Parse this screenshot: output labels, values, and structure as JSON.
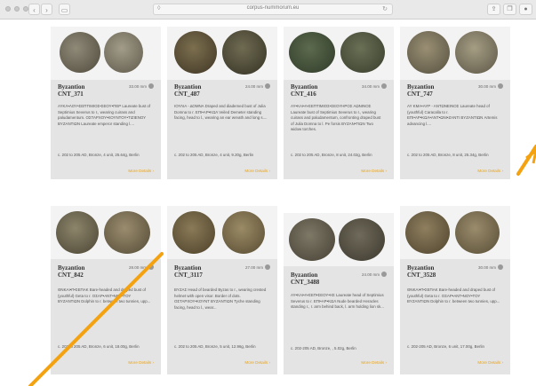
{
  "browser": {
    "url": "corpus-nummorum.eu",
    "back_icon": "chevron-left",
    "forward_icon": "chevron-right",
    "sidebar_icon": "sidebar",
    "shield_icon": "shield",
    "reload_icon": "reload",
    "share_icon": "share",
    "tabs_icon": "tabs",
    "download_icon": "download"
  },
  "accent_color": "#e8a41c",
  "cards": [
    {
      "city": "Byzantion",
      "id": "CNT_371",
      "size": "33.00 mm",
      "desc": "ΑΥΚΛ•ΛΟΥ•ΣΕΠΤΙΜΙΟΣ•ΣΕΟΥ•ΠΕΡ Laureate bust of Septimius Severus to r., wearing cuirass and paludamentum. ΟΣΤΑΡΧΟΥ•ΚΟΥΝΤΟΥ•ΤΙΖΙΕΝΟΥ ΒΥΖΑΝΤΙΩΝ Laureate emperor standing l....",
      "meta": "c. 202 to 205 AD, Bronze, 4 unit, 25.64g, Berlin",
      "more": "More Details ›"
    },
    {
      "city": "Byzantion",
      "id": "CNT_487",
      "size": "24.00 mm",
      "desc": "ΙΟΥΛΙΑ - ΔΟΜΝΑ Draped and diademed bust of Julia Domna to r. ΕΠΙ•ΑΡ•ΚΩΛ Veiled Demeter standing facing, head to l., wearing an ear wreath and long s....",
      "meta": "c. 202 to 205 AD, Bronze, 4 unit, 9.20g, Berlin",
      "more": "More Details ›"
    },
    {
      "city": "Byzantion",
      "id": "CNT_416",
      "size": "34.00 mm",
      "desc": "ΑΥ•ΚΑΙ•Λ•ΣΕΠΤΙΜΙΟΣ•ΣΕΟΥΗΡΟΣ ΑΩΝΙΝΟΣ Laureate bust of Septimius Severus to r., wearing cuirass and paludamentum, confronting draped bust of Julia Domna to l. Pe forsis ΒΥΖΑΝ•ΤΙΩΝ Two widow torches.",
      "meta": "c. 202 to 205 AD, Bronze, 8 unit, 24.02g, Berlin",
      "more": "More Details ›"
    },
    {
      "city": "Byzantion",
      "id": "CNT_747",
      "size": "30.00 mm",
      "desc": "ΑΥ ΚΜΑ•ΑΥΡ - ΑΝΤΩΝΕΙΝΟΣ Laureate head of (youthful) Caracalla to r. ΕΠΙ•ΑΡ•ΚΩΛ•ΑΝΤ•ΩΝΙ•ΖΑΝΤΙ ΒΥΖΑΝΤΙΩΝ Artemis advancing l....",
      "meta": "c. 202 to 205 AD, Bronze, 8 unit, 25.34g, Berlin",
      "more": "More Details ›"
    },
    {
      "city": "Byzantion",
      "id": "CNT_842",
      "size": "28.00 mm",
      "desc": "ΘΝΚΑΙ•Π•ΣΕΠΑΚ Bare-headed and draped bust of (youthful) Geta to r. ΟΣΑΡ•ΑΝΤ•ΝΟΥ•ΤΟΥ ΒΥΖΑΝΤΙΩΝ Dolphin to r. between two tunnies, upp...",
      "meta": "c. 202 to 205 AD, Bronze, 6 unit, 18.00g, Berlin",
      "more": "More Details ›"
    },
    {
      "city": "Byzantion",
      "id": "CNT_3117",
      "size": "27.00 mm",
      "desc": "ΒΥΖΑΣ Head of bearded Byzas to r., wearing crested helmet with open visor. Border of dots. ΟΣΤΑΡΧΟΥ•ΚΟΥΝΤ ΒΥΖΑΝΤΙΩΝ Tyche standing facing, head to l., wear...",
      "meta": "c. 202 to 205 AD, Bronze, 5 unit, 12.96g, Berlin",
      "more": "More Details ›"
    },
    {
      "city": "Byzantion",
      "id": "CNT_3488",
      "size": "24.00 mm",
      "desc": "ΑΥ•ΚΑΙ•Λ•ΣΕΠ•ΣΕΟΥ•ΗΣ Laureate head of Septimius Severus to r. ΕΠΙ•ΑΡ•ΚΩΛ Nude bearded Heracles standing r., r. arm behind back, l. arm holding lion sk...",
      "meta": "c. 202-205 AD, Bronze, , 5.02g, Berlin",
      "more": "More Details ›"
    },
    {
      "city": "Byzantion",
      "id": "CNT_3528",
      "size": "30.00 mm",
      "desc": "ΘΝΚΑΙ•Π•ΣΕΠΑΚ Bare-headed and draped bust of (youthful) Geta to r. ΟΣΑΡ•ΑΝΤ•ΝΟΥ•ΤΟΥ ΒΥΖΑΝΤΙΩΝ Dolphin to r. between two tunnies, upp...",
      "meta": "c. 202-205 AD, Bronze, 6 unit, 17.00g, Berlin",
      "more": "More Details ›"
    }
  ]
}
